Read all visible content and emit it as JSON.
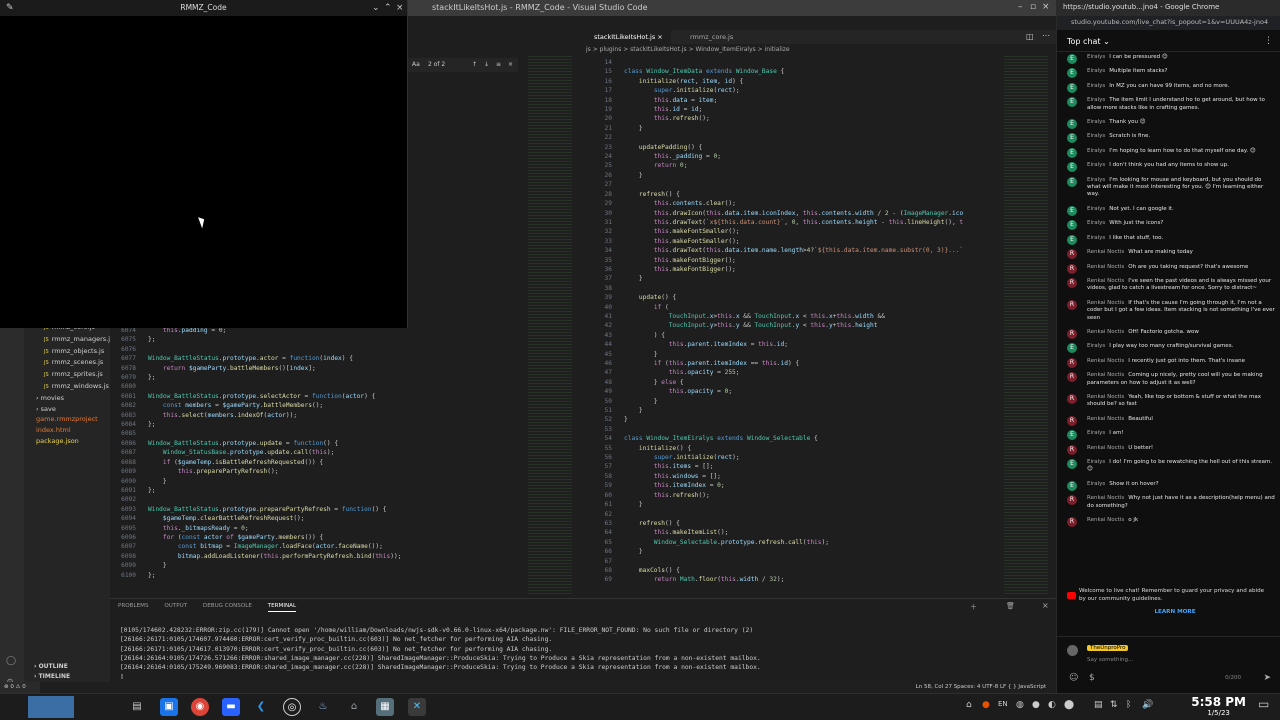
{
  "vscode": {
    "window_title": "stackItLikeItsHot.js - RMMZ_Code - Visual Studio Code",
    "tabs": [
      {
        "label": "stackItLikeItsHot.js",
        "active": true
      },
      {
        "label": "rmmz_core.js",
        "active": false
      }
    ],
    "breadcrumb": "js > plugins > stackItLikeItsHot.js > Window_ItemEiralys > initialize",
    "find_count": "2 of 2",
    "sidebar_items": [
      {
        "label": "rmmz_core.js",
        "type": "file"
      },
      {
        "label": "rmmz_managers.js",
        "type": "file"
      },
      {
        "label": "rmmz_objects.js",
        "type": "file"
      },
      {
        "label": "rmmz_scenes.js",
        "type": "file"
      },
      {
        "label": "rmmz_sprites.js",
        "type": "file"
      },
      {
        "label": "rmmz_windows.js",
        "type": "file"
      },
      {
        "label": "movies",
        "type": "folder"
      },
      {
        "label": "save",
        "type": "folder"
      },
      {
        "label": "game.rmmzproject",
        "type": "other"
      },
      {
        "label": "index.html",
        "type": "other"
      },
      {
        "label": "package.json",
        "type": "other"
      }
    ],
    "outline_label": "OUTLINE",
    "timeline_label": "TIMELINE",
    "panel_tabs": [
      "PROBLEMS",
      "OUTPUT",
      "DEBUG CONSOLE",
      "TERMINAL"
    ],
    "terminal_lines": [
      "[0105/174602.428232:ERROR:zip.cc(179)] Cannot open '/home/william/Downloads/nwjs-sdk-v0.66.0-linux-x64/package.nw': FILE_ERROR_NOT_FOUND: No such file or directory (2)",
      "[26166:26171:0105/174607.974460:ERROR:cert_verify_proc_builtin.cc(603)] No net_fetcher for performing AIA chasing.",
      "[26166:26171:0105/174617.013970:ERROR:cert_verify_proc_builtin.cc(603)] No net_fetcher for performing AIA chasing.",
      "[26164:26164:0105/174726.571266:ERROR:shared_image_manager.cc(228)] SharedImageManager::ProduceSkia: Trying to Produce a Skia representation from a non-existent mailbox.",
      "[26164:26164:0105/175249.969083:ERROR:shared_image_manager.cc(228)] SharedImageManager::ProduceSkia: Trying to Produce a Skia representation from a non-existent mailbox."
    ],
    "status_right": "Ln 58, Col 27   Spaces: 4   UTF-8   LF   { } JavaScript",
    "status_left": "⊗ 0 ⚠ 0"
  },
  "popup": {
    "title": "RMMZ_Code"
  },
  "chrome": {
    "title": "https://studio.youtub...jno4 - Google Chrome",
    "url": "studio.youtube.com/live_chat?is_popout=1&v=UUUA4z-jno4",
    "chat_mode": "Top chat",
    "messages": [
      {
        "name": "Eiralys",
        "text": "I can be pressured 😊",
        "color": "#1d8a5e"
      },
      {
        "name": "Eiralys",
        "text": "Multiple item stacks?",
        "color": "#1d8a5e"
      },
      {
        "name": "Eiralys",
        "text": "In MZ you can have 99 items, and no more.",
        "color": "#1d8a5e"
      },
      {
        "name": "Eiralys",
        "text": "The item limit I understand ho to get around, but how to allow more stacks like in crafting games.",
        "color": "#1d8a5e"
      },
      {
        "name": "Eiralys",
        "text": "Thank you 😊",
        "color": "#1d8a5e"
      },
      {
        "name": "Eiralys",
        "text": "Scratch is fine.",
        "color": "#1d8a5e"
      },
      {
        "name": "Eiralys",
        "text": "I'm hoping to learn how to do that myself one day. 😊",
        "color": "#1d8a5e"
      },
      {
        "name": "Eiralys",
        "text": "I don't think you had any items to show up.",
        "color": "#1d8a5e"
      },
      {
        "name": "Eiralys",
        "text": "I'm looking for mouse and keyboard, but you should do what will make it most interesting for you. 😊 I'm learning either way.",
        "color": "#1d8a5e"
      },
      {
        "name": "Eiralys",
        "text": "Not yet. I can google it.",
        "color": "#1d8a5e"
      },
      {
        "name": "Eiralys",
        "text": "With just the icons?",
        "color": "#1d8a5e"
      },
      {
        "name": "Eiralys",
        "text": "I like that stuff, too.",
        "color": "#1d8a5e"
      },
      {
        "name": "Renkai Noctis",
        "text": "What are making today",
        "color": "#7a1f2b"
      },
      {
        "name": "Renkai Noctis",
        "text": "Oh are you taking request? that's awesome",
        "color": "#7a1f2b"
      },
      {
        "name": "Renkai Noctis",
        "text": "I've seen the past videos and is always missed your videos, glad to catch a livestream for once. Sorry to distract~",
        "color": "#7a1f2b"
      },
      {
        "name": "Renkai Noctis",
        "text": "If that's the cause I'm going through it, I'm not a coder but I got a few ideas. Item stacking is not something I've ever seen",
        "color": "#7a1f2b"
      },
      {
        "name": "Renkai Noctis",
        "text": "OH! Factorio gotcha. wow",
        "color": "#7a1f2b"
      },
      {
        "name": "Eiralys",
        "text": "I play way too many crafting/survival games.",
        "color": "#1d8a5e"
      },
      {
        "name": "Renkai Noctis",
        "text": "I recently just got into them. That's insane",
        "color": "#7a1f2b"
      },
      {
        "name": "Renkai Noctis",
        "text": "Coming up nicely, pretty cool will you be making parameters on how to adjust it as well?",
        "color": "#7a1f2b"
      },
      {
        "name": "Renkai Noctis",
        "text": "Yeah, like top or bottom & stuff or what the max should be? so fast",
        "color": "#7a1f2b"
      },
      {
        "name": "Renkai Noctis",
        "text": "Beautiful",
        "color": "#7a1f2b"
      },
      {
        "name": "Eiralys",
        "text": "I am!",
        "color": "#1d8a5e"
      },
      {
        "name": "Renkai Noctis",
        "text": "U better!",
        "color": "#7a1f2b"
      },
      {
        "name": "Eiralys",
        "text": "I do! I'm going to be rewatching the hell out of this stream. 😊",
        "color": "#1d8a5e"
      },
      {
        "name": "Eiralys",
        "text": "Show it on hover?",
        "color": "#1d8a5e"
      },
      {
        "name": "Renkai Noctis",
        "text": "Why not just have it as a description(help menu) and do something?",
        "color": "#7a1f2b"
      },
      {
        "name": "Renkai Noctis",
        "text": "o jk",
        "color": "#7a1f2b"
      }
    ],
    "welcome_text": "Welcome to live chat! Remember to guard your privacy and abide by our community guidelines.",
    "learn_more": "LEARN MORE",
    "input_username": "TheUnproPro",
    "input_placeholder": "Say something...",
    "char_count": "0/200"
  },
  "taskbar": {
    "time": "5:58 PM",
    "date": "1/5/23",
    "tray_lang": "EN"
  },
  "colors": {
    "accent": "#3ea6ff",
    "vscode_bg": "#1e1e1e",
    "chat_bg": "#0f0f0f"
  }
}
